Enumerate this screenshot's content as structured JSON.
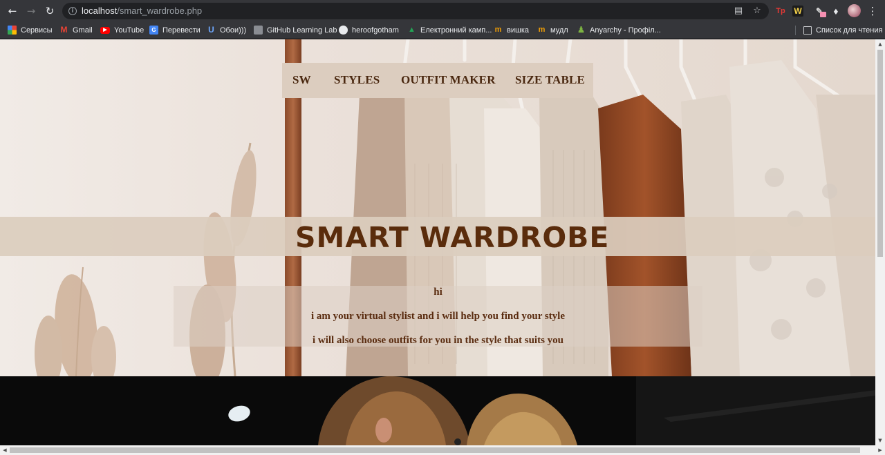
{
  "browser": {
    "url_host": "localhost",
    "url_path": "/smart_wardrobe.php",
    "icons": {
      "back": "arrow-left-icon",
      "forward": "arrow-right-icon",
      "reload": "reload-icon",
      "info": "info-icon",
      "translate": "translate-icon",
      "bookmark_star": "star-icon",
      "extensions": "puzzle-icon",
      "menu": "kebab-menu-icon"
    },
    "extensions": {
      "tp": "Tp",
      "w": "W"
    },
    "bookmarks": [
      {
        "label": "Сервисы",
        "icon": "apps-grid-icon"
      },
      {
        "label": "Gmail",
        "icon": "gmail-icon"
      },
      {
        "label": "YouTube",
        "icon": "youtube-icon"
      },
      {
        "label": "Перевести",
        "icon": "translate-icon"
      },
      {
        "label": "Обои)))",
        "icon": "u-logo-icon"
      },
      {
        "label": "GitHub Learning Lab",
        "icon": "github-lab-icon"
      },
      {
        "label": "heroofgotham",
        "icon": "github-icon"
      },
      {
        "label": "Електронний камп...",
        "icon": "campus-icon"
      },
      {
        "label": "вишка",
        "icon": "moodle-icon"
      },
      {
        "label": "мудл",
        "icon": "moodle-icon"
      },
      {
        "label": "Anyarchy - Профіл...",
        "icon": "anyarchy-icon"
      }
    ],
    "reading_list": "Список для чтения"
  },
  "page": {
    "nav": {
      "links": [
        "SW",
        "STYLES",
        "OUTFIT MAKER",
        "SIZE TABLE"
      ]
    },
    "title": "SMART WARDROBE",
    "intro": {
      "greeting": "hi",
      "line1": "i am your virtual stylist and i will help you find your style",
      "line2": "i will also choose outfits for you in the style that suits you"
    }
  },
  "colors": {
    "brand_brown": "#5a2c0c",
    "nav_bg": "#dccdbf",
    "banner_bg": "#dbcdbe"
  }
}
